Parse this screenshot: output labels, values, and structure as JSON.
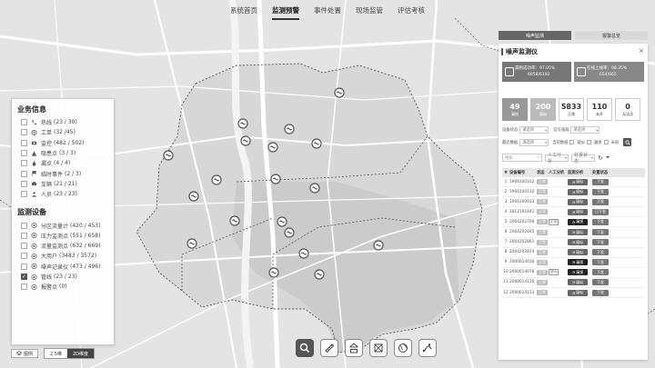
{
  "nav": [
    "系统首页",
    "监测预警",
    "事件处置",
    "现场监管",
    "评估考核"
  ],
  "nav_active": 1,
  "left_panel": {
    "business_title": "业务信息",
    "business": [
      {
        "label": "热线",
        "count": "(23 / 30)",
        "icon": "phone-icon",
        "checked": false
      },
      {
        "label": "工单",
        "count": "(32 /45)",
        "icon": "globe-icon",
        "checked": false
      },
      {
        "label": "监控",
        "count": "(482 / 502)",
        "icon": "camera-icon",
        "checked": false
      },
      {
        "label": "隐患点",
        "count": "(3 / 3)",
        "icon": "warning-icon",
        "checked": false
      },
      {
        "label": "漏点",
        "count": "(4 / 4)",
        "icon": "leak-icon",
        "checked": false
      },
      {
        "label": "临时事件",
        "count": "(2 / 3)",
        "icon": "flag-icon",
        "checked": false
      },
      {
        "label": "车辆",
        "count": "(21 / 21)",
        "icon": "car-icon",
        "checked": false
      },
      {
        "label": "人员",
        "count": "(23 / 23)",
        "icon": "person-icon",
        "checked": false
      }
    ],
    "device_title": "监测设备",
    "devices": [
      {
        "label": "分区流量计",
        "count": "(420 / 453)",
        "icon": "flow-meter-icon",
        "checked": false
      },
      {
        "label": "压力监测点",
        "count": "(551 / 658)",
        "icon": "pressure-icon",
        "checked": false
      },
      {
        "label": "流量监测点",
        "count": "(632 / 669)",
        "icon": "flow-point-icon",
        "checked": false
      },
      {
        "label": "大用户",
        "count": "(3483 / 3572)",
        "icon": "big-user-icon",
        "checked": false
      },
      {
        "label": "噪声记录仪",
        "count": "(473 / 496)",
        "icon": "noise-recorder-icon",
        "checked": false
      },
      {
        "label": "管线",
        "count": "(23 / 23)",
        "icon": "pipeline-icon",
        "checked": true
      },
      {
        "label": "报警点",
        "count": "(0)",
        "icon": "alarm-icon",
        "checked": false
      }
    ]
  },
  "bottom_bar": {
    "layer_label": "图例",
    "mode_2_5d": "2.5维",
    "mode_2d": "2D维度"
  },
  "toolbar": [
    "search-icon",
    "ruler-icon",
    "merge-icon",
    "frame-icon",
    "globe-icon",
    "route-icon"
  ],
  "right_panel": {
    "tab_active": "噪声监测",
    "tab_other": "报警总览",
    "title": "噪声监测仪",
    "card1": {
      "label": "漏损成功率：97.05%",
      "value": "6058/6192"
    },
    "card2": {
      "label": "在线上线率：98.35%",
      "value": "654/665"
    },
    "stats": [
      {
        "n": "49",
        "l": "漏损"
      },
      {
        "n": "200",
        "l": "疑似"
      },
      {
        "n": "5833",
        "l": "正常"
      },
      {
        "n": "110",
        "l": "未开"
      },
      {
        "n": "0",
        "l": "无法点"
      }
    ],
    "filter1": {
      "label1": "设备状态",
      "value1": "请选择",
      "label2": "信号强弱",
      "value2": "请选择"
    },
    "filter2": {
      "label1": "最近数据",
      "value1": "请选择",
      "label2": "当前数据",
      "opt1": "疑似",
      "opt2": "漏损",
      "opt3": "未知"
    },
    "search_placeholder": "搜索",
    "filter_tag1": "人工分析",
    "filter_tag2": "处置状态",
    "columns": [
      "#",
      "设备编号",
      "状态",
      "人工分析",
      "监测分析",
      "处置状态"
    ],
    "rows": [
      {
        "no": "1",
        "id": "1906100102",
        "status": "正常",
        "manual": "",
        "analysis": "疑似",
        "dark": false,
        "dispose": "下发"
      },
      {
        "no": "2",
        "id": "1906100132",
        "status": "正常",
        "manual": "",
        "analysis": "疑似",
        "dark": false,
        "dispose": "下发"
      },
      {
        "no": "3",
        "id": "1906100033",
        "status": "正常",
        "manual": "",
        "analysis": "疑似",
        "dark": false,
        "dispose": "下发"
      },
      {
        "no": "4",
        "id": "1812191841",
        "status": "正常",
        "manual": "",
        "analysis": "疑似",
        "dark": false,
        "dispose": "已下发"
      },
      {
        "no": "5",
        "id": "2004202700",
        "status": "正常",
        "manual": "正常",
        "analysis": "漏损",
        "dark": true,
        "dispose": "下发"
      },
      {
        "no": "6",
        "id": "2004202845",
        "status": "正常",
        "manual": "",
        "analysis": "疑似",
        "dark": false,
        "dispose": "下发"
      },
      {
        "no": "7",
        "id": "2004202861",
        "status": "正常",
        "manual": "",
        "analysis": "疑似",
        "dark": false,
        "dispose": "下发"
      },
      {
        "no": "8",
        "id": "2004202874",
        "status": "正常",
        "manual": "",
        "analysis": "疑似",
        "dark": false,
        "dispose": "下发"
      },
      {
        "no": "9",
        "id": "2000014030",
        "status": "正常",
        "manual": "",
        "analysis": "漏损",
        "dark": true,
        "dispose": "下发"
      },
      {
        "no": "10",
        "id": "2000014078",
        "status": "正常",
        "manual": "疑似",
        "analysis": "漏损",
        "dark": true,
        "dispose": "下发"
      },
      {
        "no": "11",
        "id": "2000014126",
        "status": "正常",
        "manual": "",
        "analysis": "疑似",
        "dark": false,
        "dispose": "下发"
      },
      {
        "no": "12",
        "id": "2000014153",
        "status": "正常",
        "manual": "",
        "analysis": "疑似",
        "dark": false,
        "dispose": "下发"
      }
    ]
  }
}
